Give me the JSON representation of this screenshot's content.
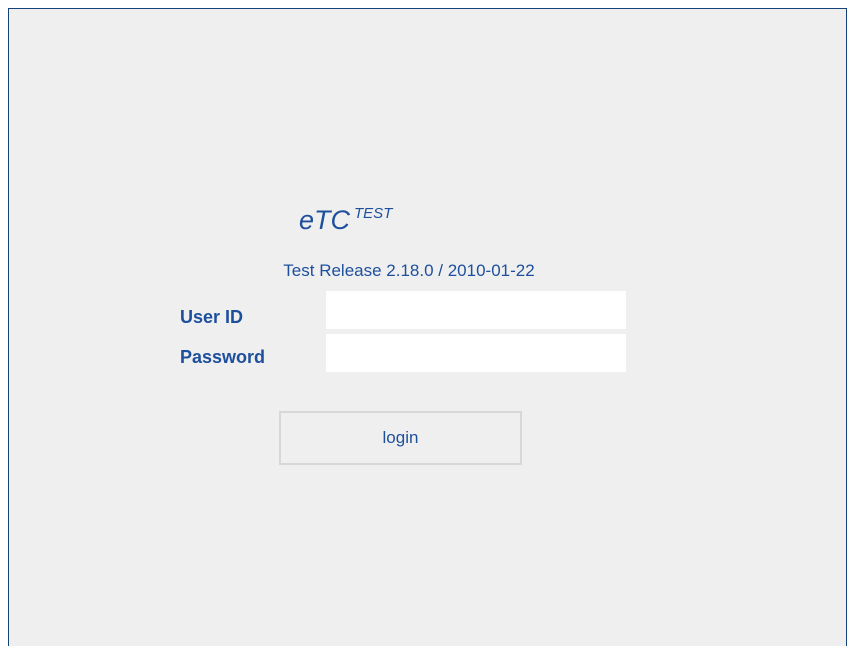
{
  "app": {
    "title_main": "eTC",
    "title_sup": "TEST",
    "version_text": "Test Release 2.18.0 / 2010-01-22"
  },
  "form": {
    "user_id_label": "User ID",
    "user_id_value": "",
    "password_label": "Password",
    "password_value": "",
    "login_label": "login"
  },
  "colors": {
    "accent": "#1d4f9c",
    "panel_bg": "#efefef",
    "border": "#16427a"
  }
}
